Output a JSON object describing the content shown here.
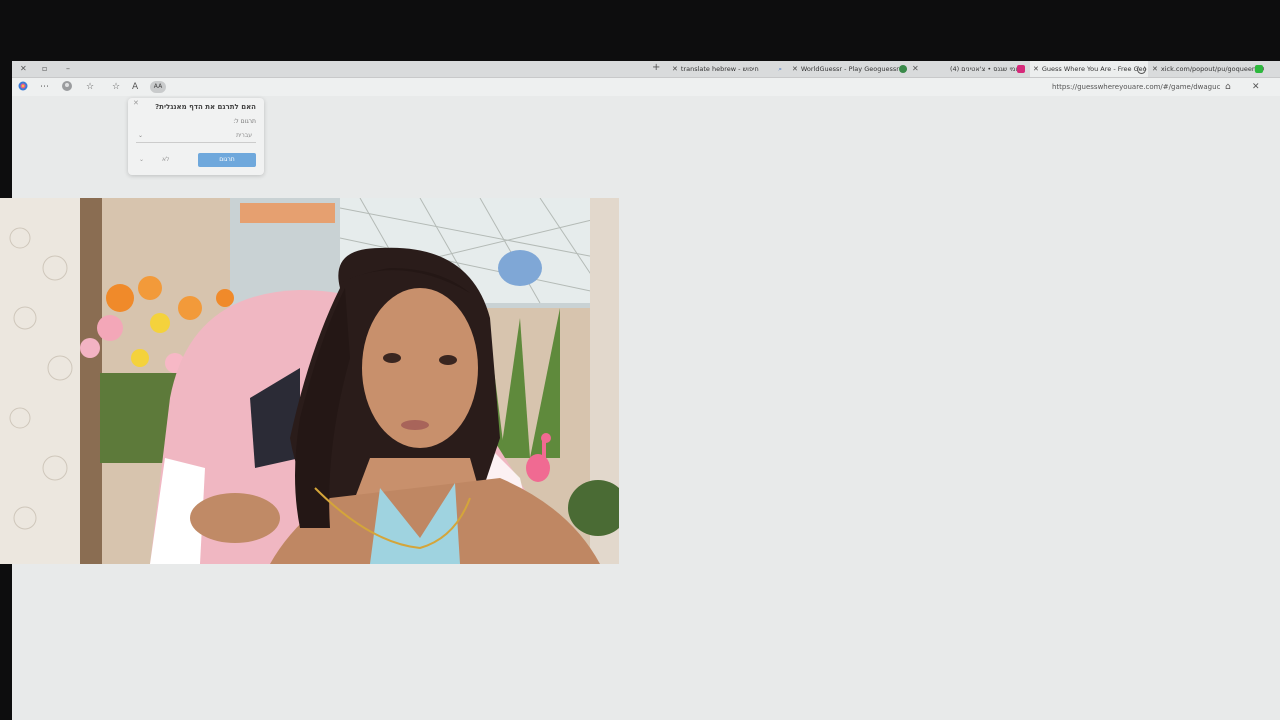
{
  "tabs": [
    {
      "label": "translate hebrew - חיפוש",
      "icon": "search-icon"
    },
    {
      "label": "WorldGuessr - Play Geoguessr fo",
      "icon": "globe-icon"
    },
    {
      "label": "(4) יומי שגנס • צ'אטינים",
      "icon": "instagram-icon"
    },
    {
      "label": "Guess Where You Are - Free Geo",
      "icon": "loading-spinner"
    },
    {
      "label": "xick.com/popout/pu/goqueen20",
      "icon": "green-square-icon"
    }
  ],
  "addressbar": {
    "url": "https://guesswhereyouare.com/#/game/dwaguc",
    "reader_label": "AA"
  },
  "translate_popup": {
    "title": "האם לתרגם את הדף מאנגלית?",
    "translate_to_label": "תרגום ל:",
    "language_value": "עברית",
    "translate_button": "תרגום",
    "not_now_button": "לא"
  },
  "colors": {
    "accent": "#6fa8dc",
    "background": "#e8eaea",
    "chair_pink": "#f0b7c2"
  }
}
